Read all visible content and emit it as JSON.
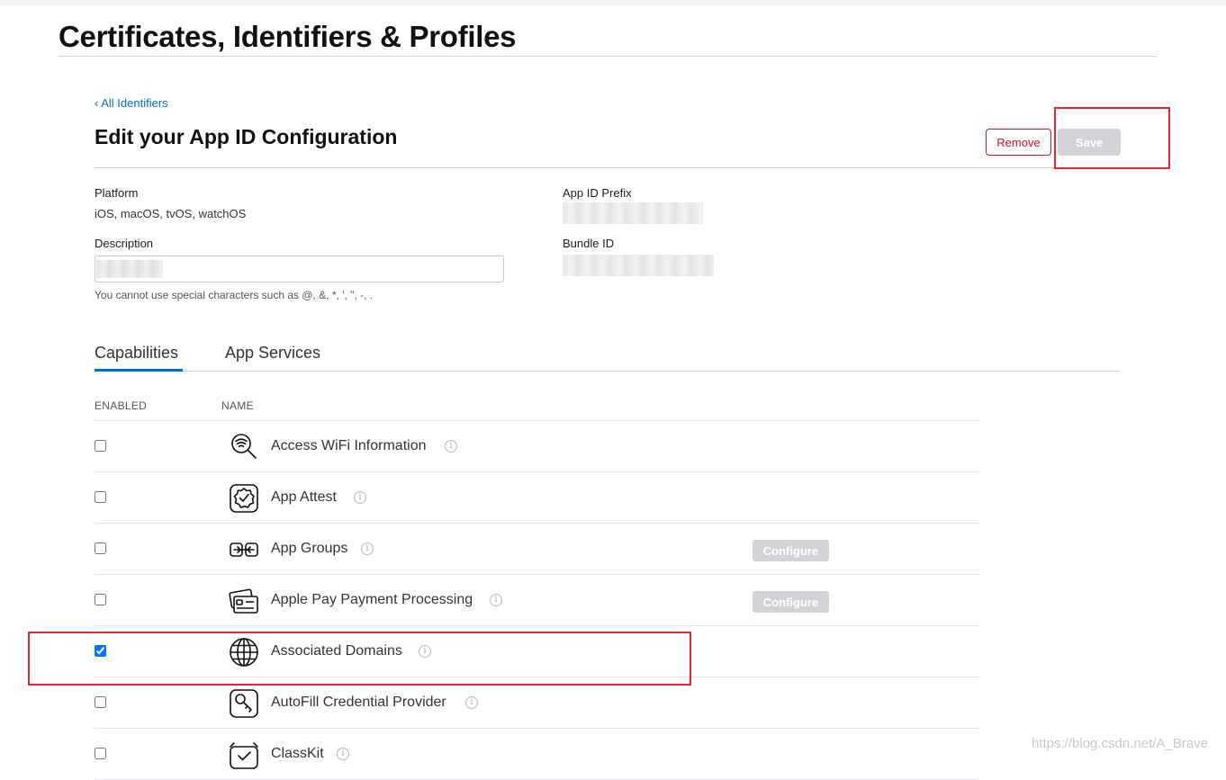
{
  "header": {
    "title": "Certificates, Identifiers & Profiles"
  },
  "nav": {
    "back_link": "‹ All Identifiers"
  },
  "section": {
    "title": "Edit your App ID Configuration",
    "remove_label": "Remove",
    "save_label": "Save"
  },
  "details": {
    "platform_label": "Platform",
    "platform_value": "iOS, macOS, tvOS, watchOS",
    "prefix_label": "App ID Prefix",
    "description_label": "Description",
    "description_value": "",
    "description_hint": "You cannot use special characters such as @, &, *, ', \", -, .",
    "bundle_label": "Bundle ID"
  },
  "tabs": [
    {
      "label": "Capabilities",
      "active": true
    },
    {
      "label": "App Services",
      "active": false
    }
  ],
  "table": {
    "headers": {
      "enabled": "ENABLED",
      "name": "NAME"
    },
    "rows": [
      {
        "name": "Access WiFi Information",
        "checked": false,
        "icon": "wifi-search-icon",
        "configure": ""
      },
      {
        "name": "App Attest",
        "checked": false,
        "icon": "badge-check-icon",
        "configure": ""
      },
      {
        "name": "App Groups",
        "checked": false,
        "icon": "app-groups-icon",
        "configure": "Configure"
      },
      {
        "name": "Apple Pay Payment Processing",
        "checked": false,
        "icon": "credit-card-icon",
        "configure": "Configure"
      },
      {
        "name": "Associated Domains",
        "checked": true,
        "icon": "globe-icon",
        "configure": ""
      },
      {
        "name": "AutoFill Credential Provider",
        "checked": false,
        "icon": "key-icon",
        "configure": ""
      },
      {
        "name": "ClassKit",
        "checked": false,
        "icon": "classkit-icon",
        "configure": ""
      }
    ]
  },
  "colors": {
    "accent": "#0070c9",
    "danger": "#d30f2e",
    "disabled": "#d2d2d7",
    "highlight": "#e8272b"
  },
  "watermark": "https://blog.csdn.net/A_Brave"
}
